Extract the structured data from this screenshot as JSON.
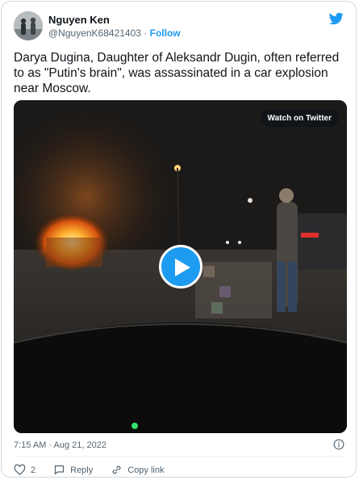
{
  "author": {
    "name": "Nguyen Ken",
    "handle": "@NguyenK68421403",
    "separator": "·",
    "follow_label": "Follow"
  },
  "tweet": {
    "text": "Darya Dugina, Daughter of Aleksandr Dugin, often referred to as \"Putin's brain\", was assassinated in a car explosion near Moscow."
  },
  "media": {
    "watch_label": "Watch on Twitter"
  },
  "meta": {
    "timestamp": "7:15 AM · Aug 21, 2022"
  },
  "actions": {
    "like_count": "2",
    "reply_label": "Reply",
    "copy_link_label": "Copy link"
  },
  "colors": {
    "brand": "#1d9bf0",
    "secondary_text": "#536471"
  },
  "icons": {
    "brand": "twitter-bird-icon",
    "play": "play-icon",
    "info": "info-icon",
    "like": "heart-icon",
    "reply": "reply-icon",
    "copy_link": "link-icon"
  }
}
